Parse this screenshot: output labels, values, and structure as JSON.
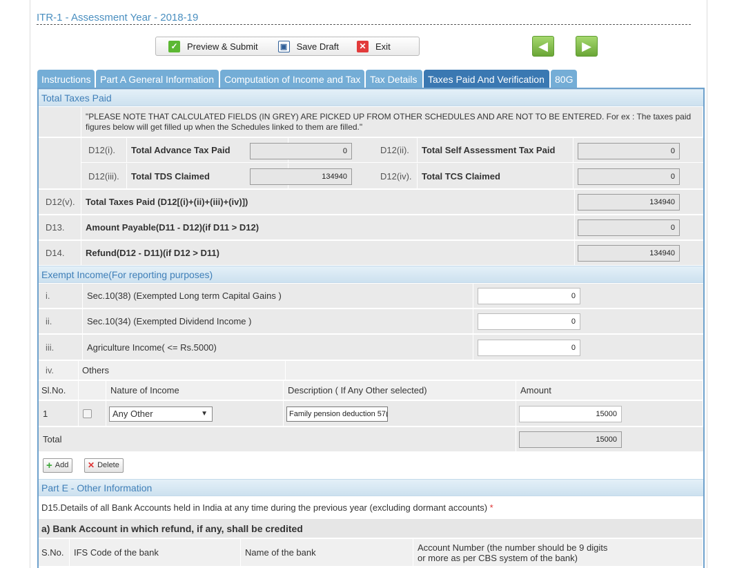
{
  "form_title": "ITR-1 - Assessment Year - 2018-19",
  "toolbar": {
    "preview_label": "Preview & Submit",
    "save_label": "Save Draft",
    "exit_label": "Exit"
  },
  "nav": {
    "prev_icon": "arrow-left-icon",
    "next_icon": "arrow-right-icon"
  },
  "tabs": [
    {
      "label": "Instructions"
    },
    {
      "label": "Part A General Information"
    },
    {
      "label": "Computation of Income and Tax"
    },
    {
      "label": "Tax Details"
    },
    {
      "label": "Taxes Paid And Verification"
    },
    {
      "label": "80G"
    }
  ],
  "active_tab": "Taxes Paid And Verification",
  "colors": {
    "tab": "#74add6",
    "tab_active": "#3a78b2",
    "section_text": "#3f7fb8",
    "add_icon": "#3aa635",
    "delete_icon": "#d33"
  },
  "taxes_paid": {
    "section_title": "Total Taxes Paid",
    "note": "\"PLEASE NOTE THAT CALCULATED FIELDS (IN GREY) ARE PICKED UP FROM OTHER SCHEDULES AND ARE NOT TO BE ENTERED. For ex : The taxes paid figures below will get filled up when the Schedules linked to them are filled.\"",
    "d12i": {
      "code": "D12(i).",
      "label": "Total Advance Tax Paid",
      "value": "0"
    },
    "d12ii": {
      "code": "D12(ii).",
      "label": "Total Self Assessment Tax Paid",
      "value": "0"
    },
    "d12iii": {
      "code": "D12(iii).",
      "label": "Total TDS Claimed",
      "value": "134940"
    },
    "d12iv": {
      "code": "D12(iv).",
      "label": "Total TCS Claimed",
      "value": "0"
    },
    "d12v": {
      "code": "D12(v).",
      "label": "Total Taxes Paid (D12[(i)+(ii)+(iii)+(iv)])",
      "value": "134940"
    },
    "d13": {
      "code": "D13.",
      "label": "Amount Payable(D11 - D12)(if D11 > D12)",
      "value": "0"
    },
    "d14": {
      "code": "D14.",
      "label": "Refund(D12 - D11)(if D12 > D11)",
      "value": "134940"
    }
  },
  "exempt": {
    "section_title": "Exempt Income(For reporting purposes)",
    "rows": [
      {
        "num": "i.",
        "label": "Sec.10(38) (Exempted Long term Capital Gains )",
        "value": "0"
      },
      {
        "num": "ii.",
        "label": "Sec.10(34) (Exempted Dividend Income )",
        "value": "0"
      },
      {
        "num": "iii.",
        "label": "Agriculture Income( <= Rs.5000)",
        "value": "0"
      }
    ],
    "others": {
      "num": "iv.",
      "label": "Others"
    },
    "table_headers": {
      "slno": "Sl.No.",
      "nature": "Nature of Income",
      "desc": "Description ( If Any Other selected)",
      "amount": "Amount"
    },
    "table_rows": [
      {
        "slno": "1",
        "nature": "Any Other",
        "desc": "Family pension deduction 57(",
        "amount": "15000"
      }
    ],
    "total": {
      "label": "Total",
      "value": "15000"
    },
    "add_label": "Add",
    "delete_label": "Delete"
  },
  "part_e": {
    "section_title": "Part E - Other Information",
    "d15": "D15.Details of all Bank Accounts held in India at any time during the previous year (excluding dormant accounts)",
    "required_mark": "*",
    "sub_title": "a) Bank Account in which refund, if any, shall be credited",
    "headers": {
      "sno": "S.No.",
      "ifsc": "IFS Code of the bank",
      "bank": "Name of the bank",
      "acct_line1": "Account Number (the number should be 9 digits",
      "acct_line2": "or more as per CBS system of the bank)"
    }
  }
}
